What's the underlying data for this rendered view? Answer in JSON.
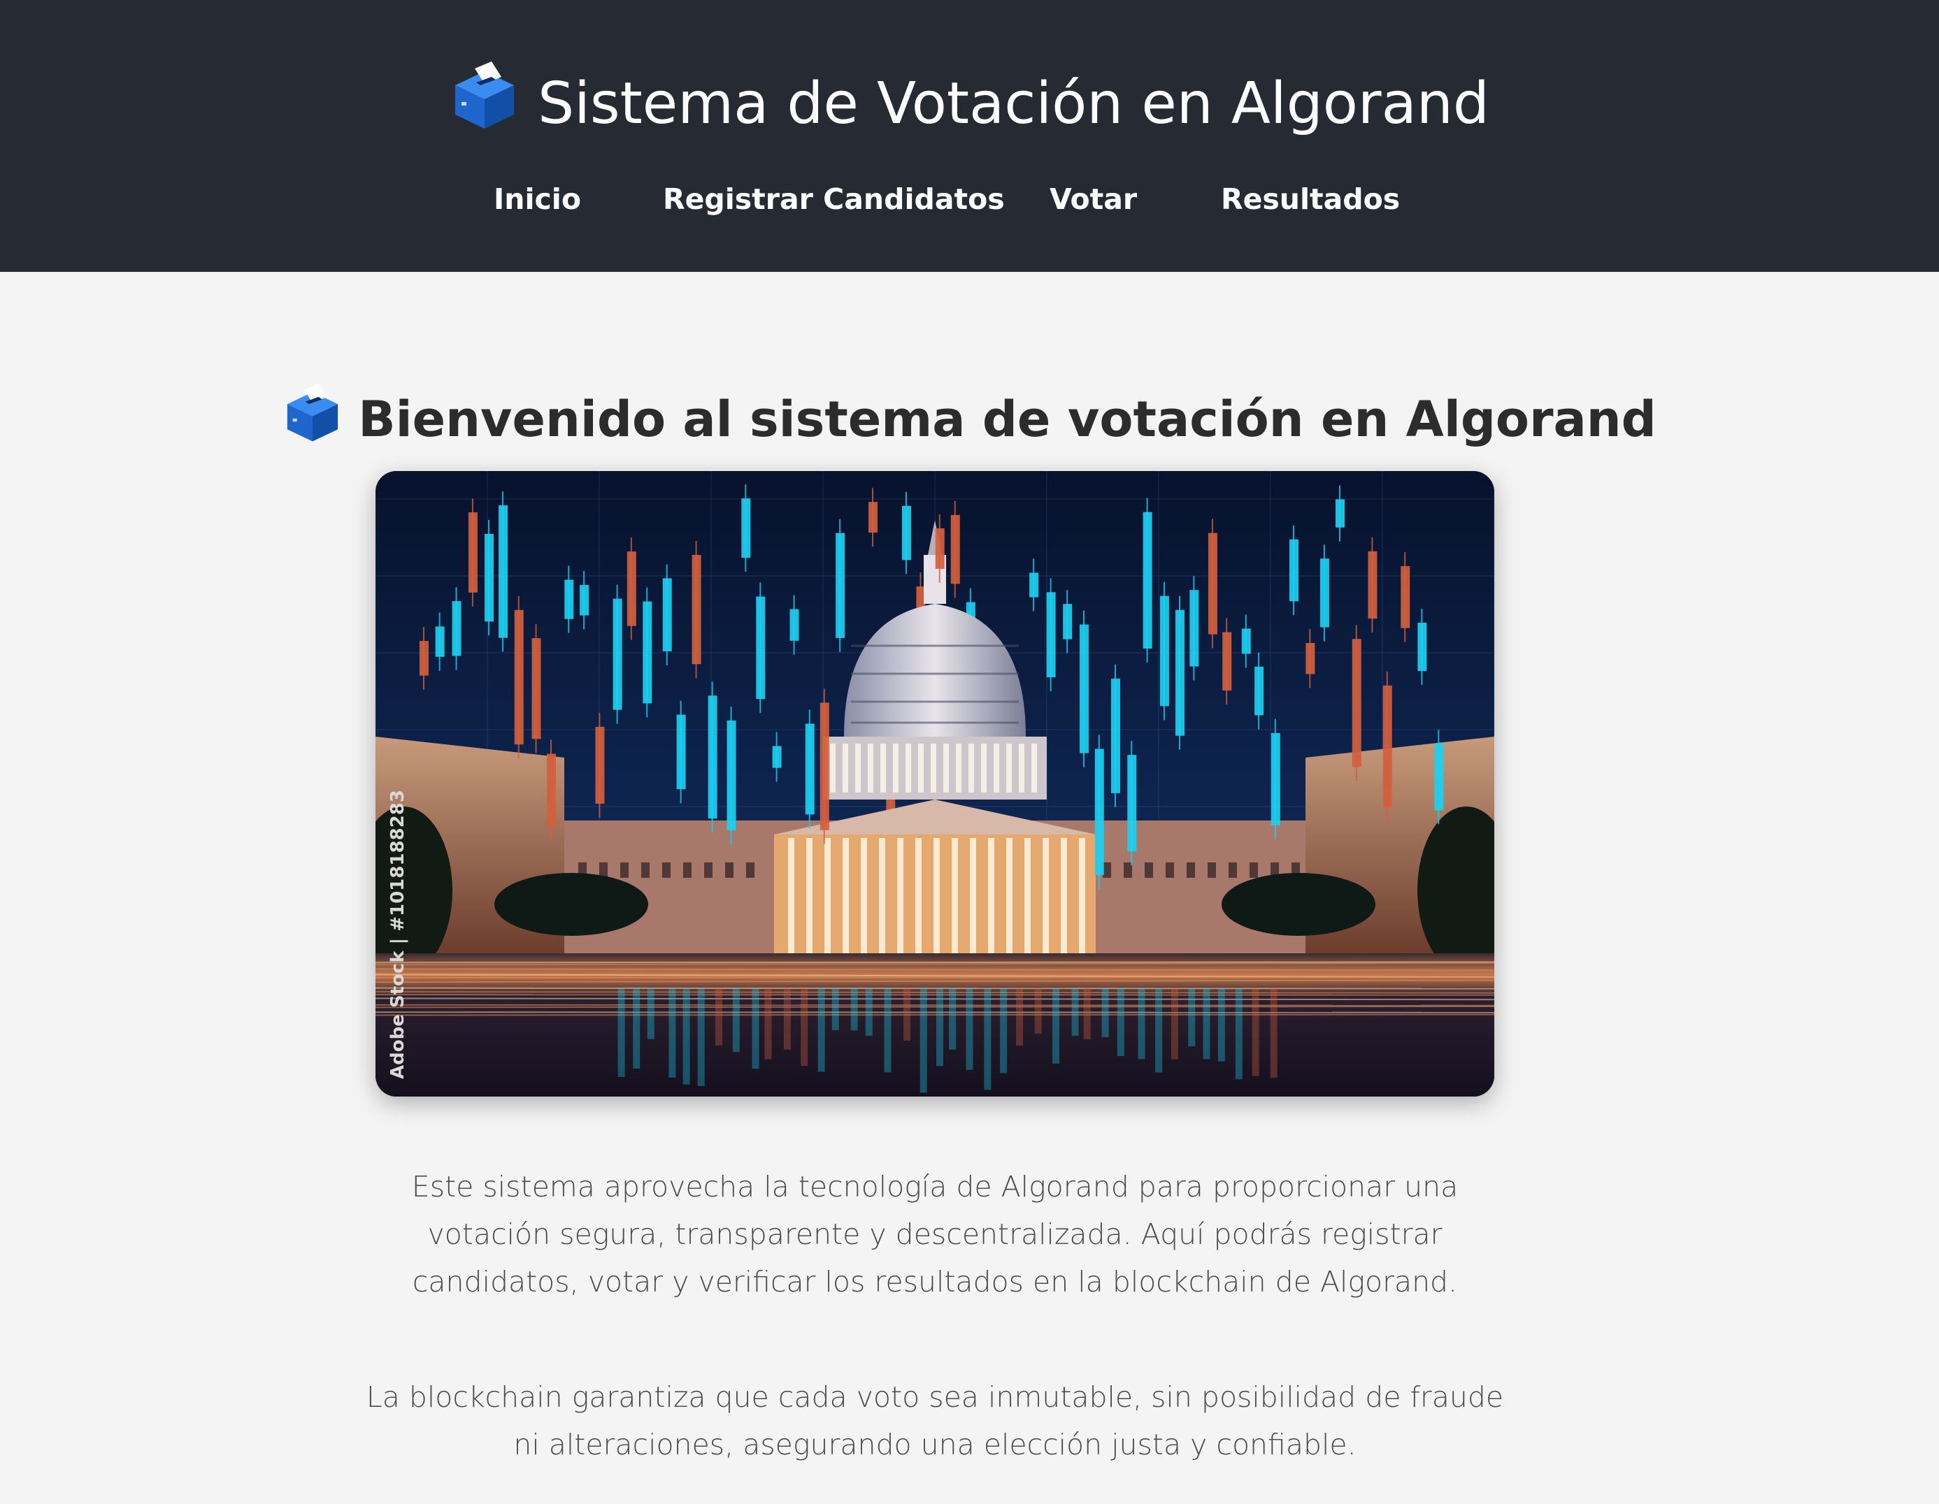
{
  "header": {
    "title": "Sistema de Votación en Algorand",
    "title_icon": "ballot-box-icon",
    "nav": [
      {
        "label": "Inicio"
      },
      {
        "label": "Registrar Candidatos"
      },
      {
        "label": "Votar"
      },
      {
        "label": "Resultados"
      }
    ]
  },
  "main": {
    "heading": "Bienvenido al sistema de votación en Algorand",
    "heading_icon": "ballot-box-icon",
    "hero_image": {
      "watermark_text": "Adobe Stock | #1018188283"
    },
    "paragraphs": [
      "Este sistema aprovecha la tecnología de Algorand para proporcionar una votación segura, transparente y descentralizada. Aquí podrás registrar candidatos, votar y verificar los resultados en la blockchain de Algorand.",
      "La blockchain garantiza que cada voto sea inmutable, sin posibilidad de fraude ni alteraciones, asegurando una elección justa y confiable."
    ]
  },
  "colors": {
    "header_bg": "#262a33",
    "page_bg": "#f4f4f4",
    "candle_up": "#1ecff0",
    "candle_down": "#d2603e"
  }
}
